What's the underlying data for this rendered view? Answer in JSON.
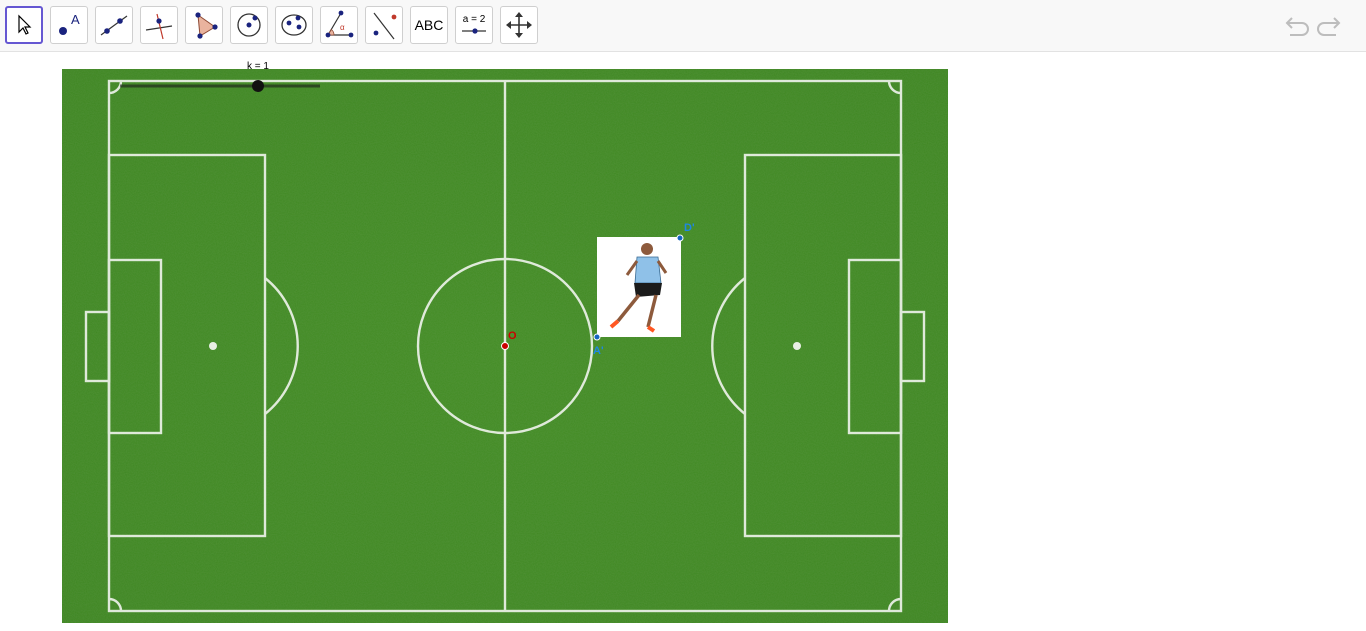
{
  "toolbar": {
    "tools": [
      {
        "name": "move-tool",
        "icon": "cursor-arrow-icon"
      },
      {
        "name": "point-tool",
        "icon": "point-icon",
        "label": "A"
      },
      {
        "name": "line-tool",
        "icon": "line-through-points-icon"
      },
      {
        "name": "perpendicular-line-tool",
        "icon": "perpendicular-line-icon"
      },
      {
        "name": "polygon-tool",
        "icon": "polygon-icon"
      },
      {
        "name": "circle-tool",
        "icon": "circle-center-point-icon"
      },
      {
        "name": "ellipse-tool",
        "icon": "ellipse-icon"
      },
      {
        "name": "angle-tool",
        "icon": "angle-icon"
      },
      {
        "name": "reflect-tool",
        "icon": "reflect-about-line-icon"
      },
      {
        "name": "text-tool",
        "icon": "text-icon",
        "label": "ABC"
      },
      {
        "name": "slider-tool",
        "icon": "slider-icon",
        "label": "a = 2"
      },
      {
        "name": "move-graphics-view-tool",
        "icon": "move-arrows-icon"
      }
    ],
    "active_tool": "move-tool",
    "accent_color": "#6557d2"
  },
  "actions": {
    "undo_icon": "undo-icon",
    "redo_icon": "redo-icon"
  },
  "graphics": {
    "slider": {
      "label": "k = 1",
      "value": 1
    },
    "points": {
      "O": {
        "label": "O",
        "color": "#cc0000"
      },
      "A": {
        "label": "A'",
        "color": "#1565c0"
      },
      "D": {
        "label": "D'",
        "color": "#1565c0"
      }
    },
    "background_image": "soccer-field",
    "overlay_image": "soccer-player"
  }
}
